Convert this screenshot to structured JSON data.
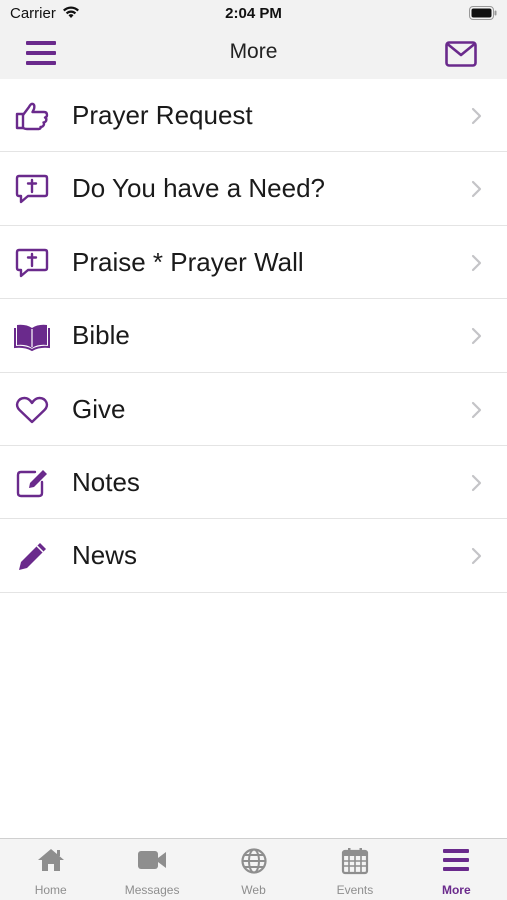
{
  "status": {
    "carrier": "Carrier",
    "time": "2:04 PM"
  },
  "header": {
    "title": "More"
  },
  "colors": {
    "accent": "#6a2a8c",
    "inactive": "#8e8e8e",
    "bar_bg": "#f2f2f2"
  },
  "menu": [
    {
      "label": "Prayer Request",
      "icon": "thumbs-up-icon"
    },
    {
      "label": "Do You have a Need?",
      "icon": "chat-cross-icon"
    },
    {
      "label": "Praise * Prayer Wall",
      "icon": "chat-cross-icon"
    },
    {
      "label": "Bible",
      "icon": "open-book-icon"
    },
    {
      "label": "Give",
      "icon": "heart-icon"
    },
    {
      "label": "Notes",
      "icon": "edit-note-icon"
    },
    {
      "label": "News",
      "icon": "pencil-icon"
    }
  ],
  "tabs": [
    {
      "label": "Home",
      "icon": "home-icon"
    },
    {
      "label": "Messages",
      "icon": "video-camera-icon"
    },
    {
      "label": "Web",
      "icon": "globe-icon"
    },
    {
      "label": "Events",
      "icon": "calendar-icon"
    },
    {
      "label": "More",
      "icon": "hamburger-icon",
      "active": true
    }
  ]
}
